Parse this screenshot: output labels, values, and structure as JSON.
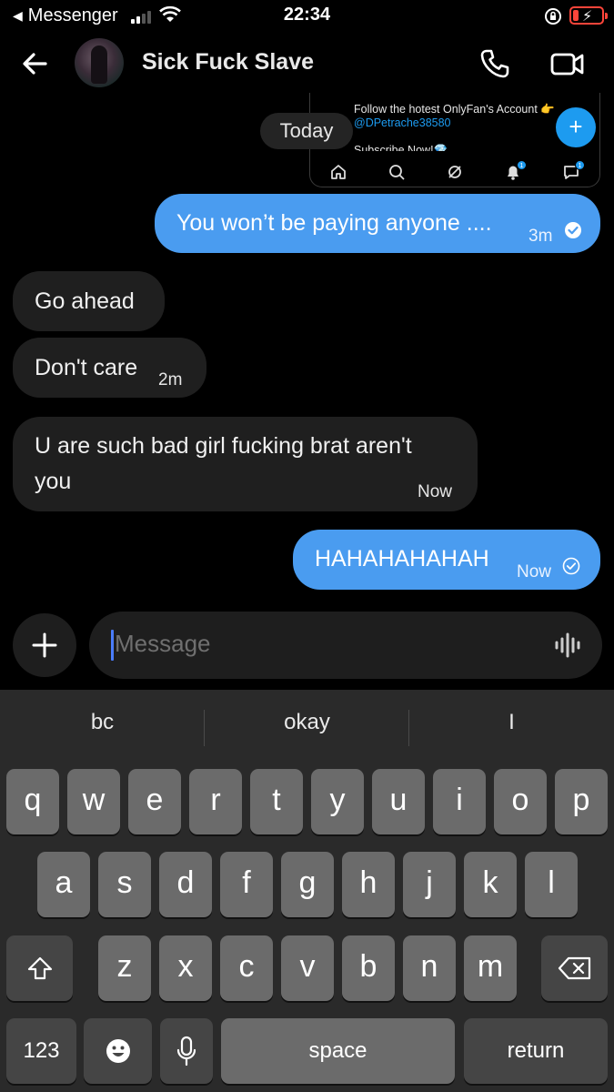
{
  "status_bar": {
    "back_app": "Messenger",
    "time": "22:34"
  },
  "header": {
    "contact_name": "Sick Fuck Slave",
    "icons": [
      "back-arrow-icon",
      "phone-icon",
      "video-camera-icon"
    ]
  },
  "shared_preview": {
    "text": "Follow the hotest OnlyFan's Account 👉",
    "handle": "@DPetrache38580",
    "sub_text": "Subscribe Now!💎",
    "fab": "+",
    "tabs": [
      "home-icon",
      "search-icon",
      "spaces-icon",
      "bell-icon",
      "messages-icon"
    ],
    "badges": [
      "1",
      "1"
    ]
  },
  "date_separator": "Today",
  "messages": [
    {
      "direction": "out",
      "text": "You won’t be paying anyone ....",
      "time": "3m",
      "status": "delivered"
    },
    {
      "direction": "in",
      "text": "Go ahead",
      "time": ""
    },
    {
      "direction": "in",
      "text": "Don't care",
      "time": "2m"
    },
    {
      "direction": "in",
      "text_line1": "U are such bad girl fucking brat aren't",
      "text_line2": "you",
      "time": "Now"
    },
    {
      "direction": "out",
      "text": "HAHAHAHAHAH",
      "time": "Now",
      "status": "sent"
    }
  ],
  "composer": {
    "placeholder": "Message",
    "icons": [
      "plus-icon",
      "voice-waveform-icon"
    ]
  },
  "keyboard": {
    "suggestions": [
      "bc",
      "okay",
      "I"
    ],
    "row1": [
      "q",
      "w",
      "e",
      "r",
      "t",
      "y",
      "u",
      "i",
      "o",
      "p"
    ],
    "row2": [
      "a",
      "s",
      "d",
      "f",
      "g",
      "h",
      "j",
      "k",
      "l"
    ],
    "row3": [
      "z",
      "x",
      "c",
      "v",
      "b",
      "n",
      "m"
    ],
    "numbers_key": "123",
    "space_key": "space",
    "return_key": "return",
    "colors": {
      "key": "#6b6b6b",
      "special_key": "#454545",
      "background": "#2a2a2a"
    }
  },
  "colors": {
    "outgoing_bubble": "#4a9cf0",
    "incoming_bubble": "#1f1f1f",
    "accent": "#1d9bf0",
    "battery_low": "#ff453a"
  }
}
